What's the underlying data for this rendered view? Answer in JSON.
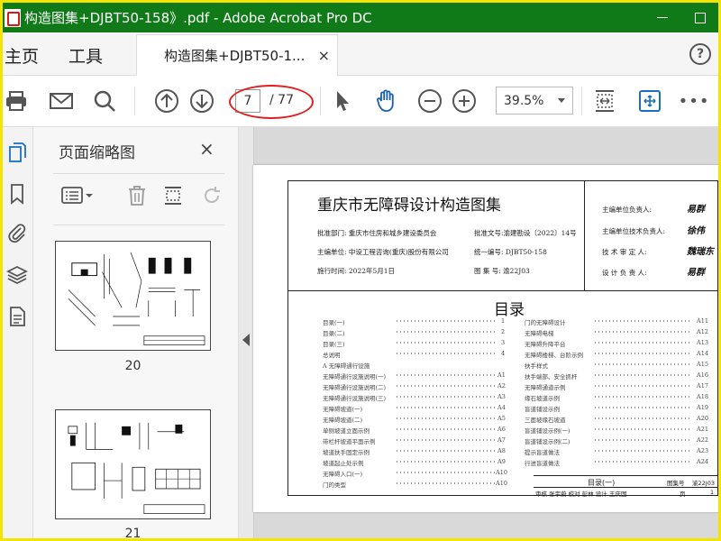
{
  "window": {
    "title": "构造图集+DJBT50-158》.pdf - Adobe Acrobat Pro DC",
    "border_color": "#f4e400",
    "titlebar_color": "#0f7a17"
  },
  "tabs": {
    "home": "主页",
    "tools": "工具",
    "document": "构造图集+DJBT50-1...",
    "close": "×",
    "help": "?"
  },
  "toolbar": {
    "icons": [
      "print-icon",
      "email-icon",
      "search-icon",
      "page-up-icon",
      "page-down-icon",
      "select-cursor-icon",
      "hand-icon",
      "zoom-out-icon",
      "zoom-in-icon",
      "fit-page-icon",
      "full-screen-icon",
      "more-icon"
    ],
    "page_current": "7",
    "page_total": "/ 77",
    "zoom": "39.5%",
    "more": "•••"
  },
  "left_rail": {
    "icons": [
      "page-thumbnails-icon",
      "bookmark-icon",
      "attachment-icon",
      "layers-icon",
      "document-properties-icon"
    ]
  },
  "thumbnails_panel": {
    "title": "页面缩略图",
    "close": "×",
    "tools": [
      "page-options-icon",
      "delete-icon",
      "crop-icon",
      "rotate-icon"
    ],
    "pages": [
      {
        "label": "20"
      },
      {
        "label": "21"
      }
    ]
  },
  "document": {
    "title": "重庆市无障碍设计构造图集",
    "info_left": [
      "批准部门: 重庆市住房和城乡建设委员会",
      "主编单位: 中设工程咨询(重庆)股份有限公司",
      "施行时间: 2022年5月1日"
    ],
    "info_right": [
      "批准文号:渝建勘设〔2022〕14号",
      "统一编号: DJBT50-158",
      "图 集 号: 渝22J03"
    ],
    "signatories": [
      {
        "role": "主编单位负责人:",
        "sign": "易群"
      },
      {
        "role": "主编单位技术负责人:",
        "sign": "徐伟"
      },
      {
        "role": "技 术 审 定 人:",
        "sign": "魏瑞东"
      },
      {
        "role": "设 计 负 责 人:",
        "sign": "易群"
      }
    ],
    "toc_title": "目录",
    "toc_left": [
      {
        "text": "目录(一)",
        "page": "1"
      },
      {
        "text": "目录(二)",
        "page": "2"
      },
      {
        "text": "目录(三)",
        "page": "3"
      },
      {
        "text": "总说明",
        "page": "4"
      },
      {
        "text": "A 无障碍通行设施",
        "page": ""
      },
      {
        "text": "无障碍通行设施说明(一)",
        "page": "A1"
      },
      {
        "text": "无障碍通行设施说明(二)",
        "page": "A2"
      },
      {
        "text": "无障碍通行设施说明(三)",
        "page": "A3"
      },
      {
        "text": "无障碍坡道(一)",
        "page": "A4"
      },
      {
        "text": "无障碍坡道(二)",
        "page": "A5"
      },
      {
        "text": "单侧坡道立面示例",
        "page": "A6"
      },
      {
        "text": "带栏杆坡道平面示例",
        "page": "A7"
      },
      {
        "text": "坡道扶手固定示例",
        "page": "A8"
      },
      {
        "text": "坡道起止处示例",
        "page": "A9"
      },
      {
        "text": "无障碍入口(一)",
        "page": "A10"
      },
      {
        "text": "门的类型",
        "page": "A10"
      }
    ],
    "toc_right": [
      {
        "text": "门的无障碍设计",
        "page": "A11"
      },
      {
        "text": "无障碍电梯",
        "page": "A12"
      },
      {
        "text": "无障碍升降平台",
        "page": "A13"
      },
      {
        "text": "无障碍楼梯、台阶示例",
        "page": "A14"
      },
      {
        "text": "扶手样式",
        "page": "A15"
      },
      {
        "text": "扶手端部、安全抓杆",
        "page": "A16"
      },
      {
        "text": "无障碍通道示例",
        "page": "A17"
      },
      {
        "text": "缘石坡道示例",
        "page": "A18"
      },
      {
        "text": "盲道铺设示例",
        "page": "A19"
      },
      {
        "text": "三面坡缘石坡道",
        "page": "A20"
      },
      {
        "text": "盲道铺设示例(一)",
        "page": "A21"
      },
      {
        "text": "盲道铺设示例(二)",
        "page": "A22"
      },
      {
        "text": "提示盲道做法",
        "page": "A23"
      },
      {
        "text": "行进盲道做法",
        "page": "A24"
      }
    ],
    "titleblock": {
      "name": "目录(一)",
      "atlas_no_label": "图集号",
      "atlas_no": "渝22J03",
      "page_label": "页",
      "page": "1",
      "row": "审核 张宇蔚  校对 彭林  设计 王庆国"
    }
  }
}
